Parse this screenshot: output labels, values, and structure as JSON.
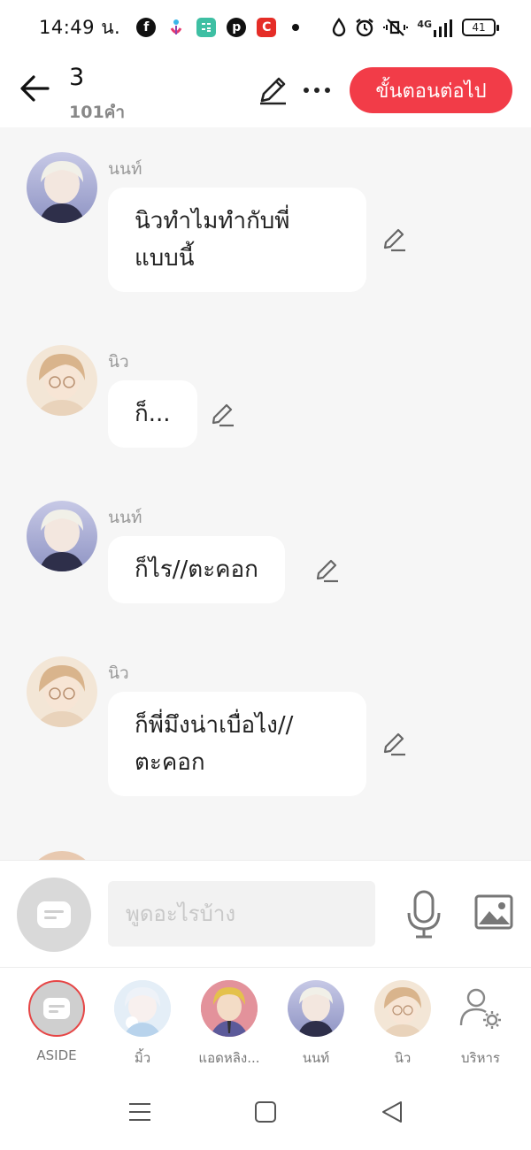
{
  "status_bar": {
    "time": "14:49 น.",
    "network": "4G",
    "battery": "41",
    "app_icons": [
      "facebook-icon",
      "tinder-icon",
      "calculator-app-icon",
      "pinterest-icon",
      "c-app-icon"
    ]
  },
  "header": {
    "title": "3",
    "word_count": "101คำ",
    "next_button": "ขั้นตอนต่อไป"
  },
  "messages": [
    {
      "sender": "นนท์",
      "lines": [
        "นิวทำไมทำกับพี่",
        "แบบนี้"
      ]
    },
    {
      "sender": "นิว",
      "lines": [
        "ก็..."
      ]
    },
    {
      "sender": "นนท์",
      "lines": [
        "ก็ไร//ตะคอก"
      ]
    },
    {
      "sender": "นิว",
      "lines": [
        "ก็พี่มึงน่าเบื่อไง//",
        "ตะคอก"
      ]
    }
  ],
  "input": {
    "placeholder": "พูดอะไรบ้าง"
  },
  "characters": [
    {
      "name": "ASIDE",
      "selected": true
    },
    {
      "name": "มิ้ว",
      "selected": false
    },
    {
      "name": "แอดหลิง...",
      "selected": false
    },
    {
      "name": "นนท์",
      "selected": false
    },
    {
      "name": "นิว",
      "selected": false
    },
    {
      "name": "บริหาร",
      "selected": false
    }
  ],
  "colors": {
    "accent": "#f23c48",
    "chat_background": "#f6f6f6",
    "bubble": "#ffffff",
    "muted_text": "#999999"
  }
}
